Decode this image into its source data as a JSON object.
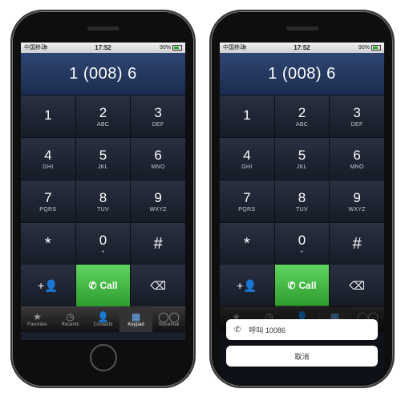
{
  "status": {
    "carrier": "中国移动",
    "time": "17:52",
    "battery": "90%"
  },
  "display": {
    "number": "1 (008) 6"
  },
  "keys": [
    {
      "digit": "1",
      "letters": ""
    },
    {
      "digit": "2",
      "letters": "ABC"
    },
    {
      "digit": "3",
      "letters": "DEF"
    },
    {
      "digit": "4",
      "letters": "GHI"
    },
    {
      "digit": "5",
      "letters": "JKL"
    },
    {
      "digit": "6",
      "letters": "MNO"
    },
    {
      "digit": "7",
      "letters": "PQRS"
    },
    {
      "digit": "8",
      "letters": "TUV"
    },
    {
      "digit": "9",
      "letters": "WXYZ"
    },
    {
      "digit": "*",
      "letters": ""
    },
    {
      "digit": "0",
      "letters": "+"
    },
    {
      "digit": "#",
      "letters": ""
    }
  ],
  "actions": {
    "add_contact_icon": "+👤",
    "call_label": "Call",
    "delete_icon": "⌫"
  },
  "tabs": [
    {
      "label": "Favorites",
      "icon": "★"
    },
    {
      "label": "Recents",
      "icon": "◷"
    },
    {
      "label": "Contacts",
      "icon": "👤"
    },
    {
      "label": "Keypad",
      "icon": "▦"
    },
    {
      "label": "Voicemail",
      "icon": "◯◯"
    }
  ],
  "sheet": {
    "call_text": "呼叫 10086",
    "cancel_text": "取消"
  },
  "colors": {
    "call_green": "#3cb43c",
    "display_blue": "#2f4571",
    "active_tab": "#6fb4ff"
  }
}
